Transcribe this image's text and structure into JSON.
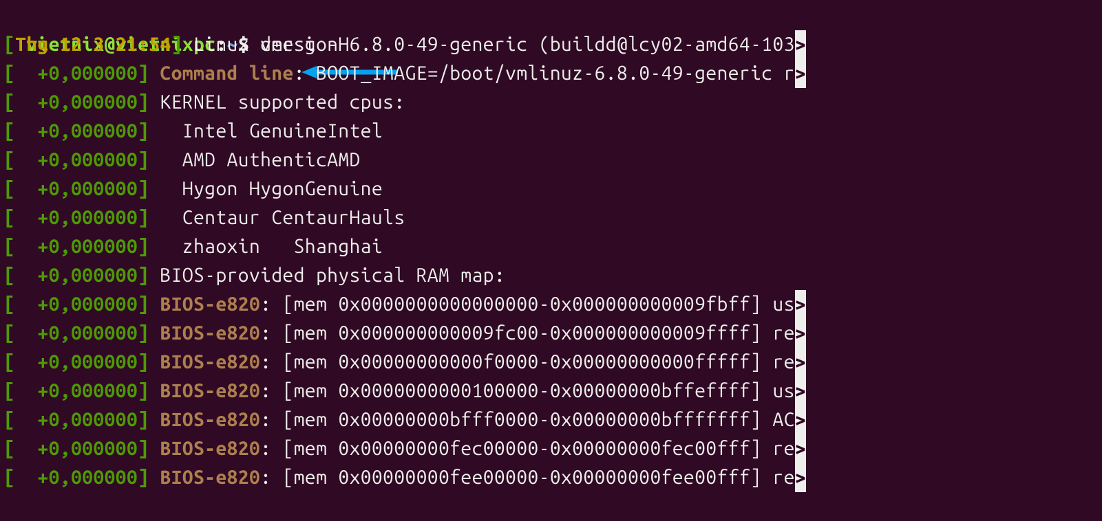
{
  "prompt": {
    "user": "vietnix",
    "at": "@",
    "host": "vietnixpc",
    "colon": ":",
    "path": "~",
    "dollar": "$ ",
    "command": "dmesg -H"
  },
  "lines": [
    {
      "bracketOpen": "[",
      "time": "Thg 12 3 21:54",
      "timeClass": "ts-start",
      "bracketClose": "]",
      "pad": " ",
      "subsys": "",
      "colon": "",
      "rest": "Linux version 6.8.0-49-generic (buildd@lcy02-amd64-103",
      "trunc": ">"
    },
    {
      "bracketOpen": "[",
      "time": "  +0,000000",
      "timeClass": "ts-delta",
      "bracketClose": "]",
      "pad": " ",
      "subsys": "Command line",
      "colon": ": ",
      "rest": "BOOT_IMAGE=/boot/vmlinuz-6.8.0-49-generic r",
      "trunc": ">"
    },
    {
      "bracketOpen": "[",
      "time": "  +0,000000",
      "timeClass": "ts-delta",
      "bracketClose": "]",
      "pad": " ",
      "subsys": "",
      "colon": "",
      "rest": "KERNEL supported cpus:",
      "trunc": ""
    },
    {
      "bracketOpen": "[",
      "time": "  +0,000000",
      "timeClass": "ts-delta",
      "bracketClose": "]",
      "pad": " ",
      "subsys": "",
      "colon": "",
      "rest": "  Intel GenuineIntel",
      "trunc": ""
    },
    {
      "bracketOpen": "[",
      "time": "  +0,000000",
      "timeClass": "ts-delta",
      "bracketClose": "]",
      "pad": " ",
      "subsys": "",
      "colon": "",
      "rest": "  AMD AuthenticAMD",
      "trunc": ""
    },
    {
      "bracketOpen": "[",
      "time": "  +0,000000",
      "timeClass": "ts-delta",
      "bracketClose": "]",
      "pad": " ",
      "subsys": "",
      "colon": "",
      "rest": "  Hygon HygonGenuine",
      "trunc": ""
    },
    {
      "bracketOpen": "[",
      "time": "  +0,000000",
      "timeClass": "ts-delta",
      "bracketClose": "]",
      "pad": " ",
      "subsys": "",
      "colon": "",
      "rest": "  Centaur CentaurHauls",
      "trunc": ""
    },
    {
      "bracketOpen": "[",
      "time": "  +0,000000",
      "timeClass": "ts-delta",
      "bracketClose": "]",
      "pad": " ",
      "subsys": "",
      "colon": "",
      "rest": "  zhaoxin   Shanghai",
      "trunc": ""
    },
    {
      "bracketOpen": "[",
      "time": "  +0,000000",
      "timeClass": "ts-delta",
      "bracketClose": "]",
      "pad": " ",
      "subsys": "",
      "colon": "",
      "rest": "BIOS-provided physical RAM map:",
      "trunc": ""
    },
    {
      "bracketOpen": "[",
      "time": "  +0,000000",
      "timeClass": "ts-delta",
      "bracketClose": "]",
      "pad": " ",
      "subsys": "BIOS-e820",
      "colon": ": ",
      "rest": "[mem 0x0000000000000000-0x000000000009fbff] us",
      "trunc": ">"
    },
    {
      "bracketOpen": "[",
      "time": "  +0,000000",
      "timeClass": "ts-delta",
      "bracketClose": "]",
      "pad": " ",
      "subsys": "BIOS-e820",
      "colon": ": ",
      "rest": "[mem 0x000000000009fc00-0x000000000009ffff] re",
      "trunc": ">"
    },
    {
      "bracketOpen": "[",
      "time": "  +0,000000",
      "timeClass": "ts-delta",
      "bracketClose": "]",
      "pad": " ",
      "subsys": "BIOS-e820",
      "colon": ": ",
      "rest": "[mem 0x00000000000f0000-0x00000000000fffff] re",
      "trunc": ">"
    },
    {
      "bracketOpen": "[",
      "time": "  +0,000000",
      "timeClass": "ts-delta",
      "bracketClose": "]",
      "pad": " ",
      "subsys": "BIOS-e820",
      "colon": ": ",
      "rest": "[mem 0x0000000000100000-0x00000000bffeffff] us",
      "trunc": ">"
    },
    {
      "bracketOpen": "[",
      "time": "  +0,000000",
      "timeClass": "ts-delta",
      "bracketClose": "]",
      "pad": " ",
      "subsys": "BIOS-e820",
      "colon": ": ",
      "rest": "[mem 0x00000000bfff0000-0x00000000bfffffff] AC",
      "trunc": ">"
    },
    {
      "bracketOpen": "[",
      "time": "  +0,000000",
      "timeClass": "ts-delta",
      "bracketClose": "]",
      "pad": " ",
      "subsys": "BIOS-e820",
      "colon": ": ",
      "rest": "[mem 0x00000000fec00000-0x00000000fec00fff] re",
      "trunc": ">"
    },
    {
      "bracketOpen": "[",
      "time": "  +0,000000",
      "timeClass": "ts-delta",
      "bracketClose": "]",
      "pad": " ",
      "subsys": "BIOS-e820",
      "colon": ": ",
      "rest": "[mem 0x00000000fee00000-0x00000000fee00fff] re",
      "trunc": ">"
    }
  ]
}
